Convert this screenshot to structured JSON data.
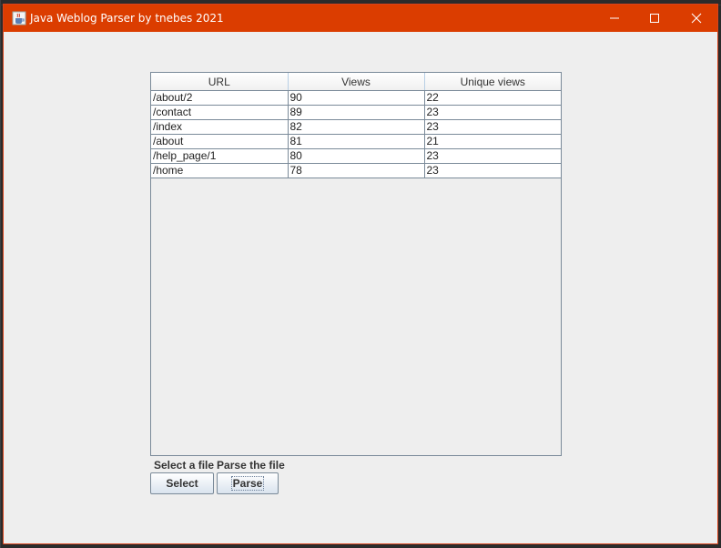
{
  "window": {
    "title": "Java Weblog Parser by tnebes 2021",
    "accent_color": "#db3d00",
    "icons": {
      "app": "java-cup-icon",
      "minimize": "minimize-icon",
      "maximize": "maximize-icon",
      "close": "close-icon"
    }
  },
  "table": {
    "columns": [
      "URL",
      "Views",
      "Unique views"
    ],
    "rows": [
      [
        "/about/2",
        "90",
        "22"
      ],
      [
        "/contact",
        "89",
        "23"
      ],
      [
        "/index",
        "82",
        "23"
      ],
      [
        "/about",
        "81",
        "21"
      ],
      [
        "/help_page/1",
        "80",
        "23"
      ],
      [
        "/home",
        "78",
        "23"
      ]
    ]
  },
  "controls": {
    "select_label": "Select a file",
    "parse_label": "Parse the file",
    "select_button": "Select",
    "parse_button": "Parse"
  }
}
